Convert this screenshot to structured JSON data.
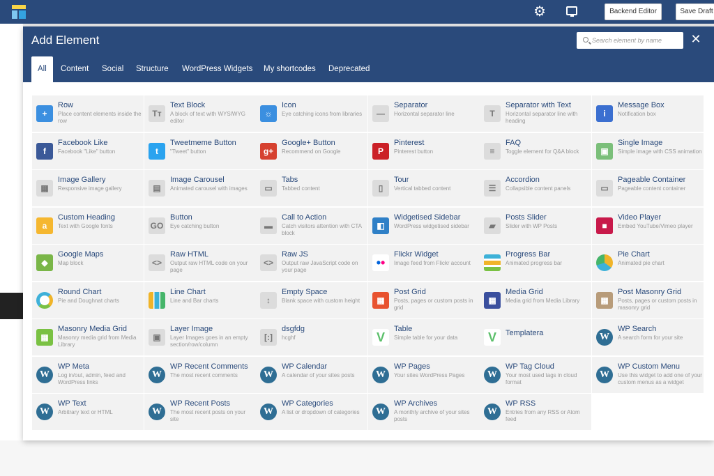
{
  "topbar": {
    "backend_editor": "Backend Editor",
    "save_draft": "Save Draft"
  },
  "modal": {
    "title": "Add Element",
    "search_placeholder": "Search element by name",
    "close": "✕",
    "tabs": [
      "All",
      "Content",
      "Social",
      "Structure",
      "WordPress Widgets",
      "My shortcodes",
      "Deprecated"
    ],
    "active_tab": "All"
  },
  "colors": {
    "header_bg": "#2a4a7b",
    "item_title": "#2a4a7b",
    "item_desc": "#999999",
    "item_bg": "#f2f2f2"
  },
  "elements": [
    [
      {
        "name": "Row",
        "desc": "Place content elements inside the row",
        "icon": "plus-icon",
        "glyph": "+",
        "color": "#3b8fe0"
      },
      {
        "name": "Text Block",
        "desc": "A block of text with WYSIWYG editor",
        "icon": "text-icon",
        "glyph": "Tт",
        "color": "light"
      },
      {
        "name": "Icon",
        "desc": "Eye catching icons from libraries",
        "icon": "sun-icon",
        "glyph": "☼",
        "color": "#3b8fe0"
      },
      {
        "name": "Separator",
        "desc": "Horizontal separator line",
        "icon": "separator-icon",
        "glyph": "—",
        "color": "light"
      },
      {
        "name": "Separator with Text",
        "desc": "Horizontal separator line with heading",
        "icon": "separator-text-icon",
        "glyph": "T",
        "color": "light"
      },
      {
        "name": "Message Box",
        "desc": "Notification box",
        "icon": "info-icon",
        "glyph": "i",
        "color": "#3b6fd0"
      }
    ],
    [
      {
        "name": "Facebook Like",
        "desc": "Facebook \"Like\" button",
        "icon": "facebook-icon",
        "glyph": "f",
        "color": "#3b5998"
      },
      {
        "name": "Tweetmeme Button",
        "desc": "\"Tweet\" button",
        "icon": "twitter-icon",
        "glyph": "t",
        "color": "#2aa3ef"
      },
      {
        "name": "Google+ Button",
        "desc": "Recommend on Google",
        "icon": "google-plus-icon",
        "glyph": "g+",
        "color": "#d6412f"
      },
      {
        "name": "Pinterest",
        "desc": "Pinterest button",
        "icon": "pinterest-icon",
        "glyph": "P",
        "color": "#cb2027"
      },
      {
        "name": "FAQ",
        "desc": "Toggle element for Q&A block",
        "icon": "faq-icon",
        "glyph": "≡",
        "color": "light"
      },
      {
        "name": "Single Image",
        "desc": "Simple image with CSS animation",
        "icon": "image-icon",
        "glyph": "▣",
        "color": "#7bbf7a"
      }
    ],
    [
      {
        "name": "Image Gallery",
        "desc": "Responsive image gallery",
        "icon": "gallery-icon",
        "glyph": "▦",
        "color": "light"
      },
      {
        "name": "Image Carousel",
        "desc": "Animated carousel with images",
        "icon": "carousel-icon",
        "glyph": "▤",
        "color": "light"
      },
      {
        "name": "Tabs",
        "desc": "Tabbed content",
        "icon": "tabs-icon",
        "glyph": "▭",
        "color": "light"
      },
      {
        "name": "Tour",
        "desc": "Vertical tabbed content",
        "icon": "tour-icon",
        "glyph": "▯",
        "color": "light"
      },
      {
        "name": "Accordion",
        "desc": "Collapsible content panels",
        "icon": "accordion-icon",
        "glyph": "☰",
        "color": "light"
      },
      {
        "name": "Pageable Container",
        "desc": "Pageable content container",
        "icon": "pageable-icon",
        "glyph": "▭",
        "color": "light"
      }
    ],
    [
      {
        "name": "Custom Heading",
        "desc": "Text with Google fonts",
        "icon": "heading-icon",
        "glyph": "a",
        "color": "#f5b730"
      },
      {
        "name": "Button",
        "desc": "Eye catching button",
        "icon": "button-icon",
        "glyph": "GO",
        "color": "light"
      },
      {
        "name": "Call to Action",
        "desc": "Catch visitors attention with CTA block",
        "icon": "cta-icon",
        "glyph": "▬",
        "color": "light"
      },
      {
        "name": "Widgetised Sidebar",
        "desc": "WordPress widgetised sidebar",
        "icon": "sidebar-icon",
        "glyph": "◧",
        "color": "#2f80c7"
      },
      {
        "name": "Posts Slider",
        "desc": "Slider with WP Posts",
        "icon": "slider-icon",
        "glyph": "▰",
        "color": "light"
      },
      {
        "name": "Video Player",
        "desc": "Embed YouTube/Vimeo player",
        "icon": "video-icon",
        "glyph": "■",
        "color": "#c8194a"
      }
    ],
    [
      {
        "name": "Google Maps",
        "desc": "Map block",
        "icon": "map-icon",
        "glyph": "◆",
        "color": "#7ab648"
      },
      {
        "name": "Raw HTML",
        "desc": "Output raw HTML code on your page",
        "icon": "html-icon",
        "glyph": "<>",
        "color": "light"
      },
      {
        "name": "Raw JS",
        "desc": "Output raw JavaScript code on your page",
        "icon": "js-icon",
        "glyph": "<>",
        "color": "light"
      },
      {
        "name": "Flickr Widget",
        "desc": "Image feed from Flickr account",
        "icon": "flickr-icon",
        "glyph": "••",
        "color": "flickr"
      },
      {
        "name": "Progress Bar",
        "desc": "Animated progress bar",
        "icon": "progress-icon",
        "glyph": "≡",
        "color": "progress"
      },
      {
        "name": "Pie Chart",
        "desc": "Animated pie chart",
        "icon": "pie-chart-icon",
        "glyph": "",
        "color": "pie"
      }
    ],
    [
      {
        "name": "Round Chart",
        "desc": "Pie and Doughnat charts",
        "icon": "round-chart-icon",
        "glyph": "",
        "color": "donut"
      },
      {
        "name": "Line Chart",
        "desc": "Line and Bar charts",
        "icon": "line-chart-icon",
        "glyph": "▮",
        "color": "bars"
      },
      {
        "name": "Empty Space",
        "desc": "Blank space with custom height",
        "icon": "empty-space-icon",
        "glyph": "↕",
        "color": "light"
      },
      {
        "name": "Post Grid",
        "desc": "Posts, pages or custom posts in grid",
        "icon": "post-grid-icon",
        "glyph": "▦",
        "color": "#e8522f"
      },
      {
        "name": "Media Grid",
        "desc": "Media grid from Media Library",
        "icon": "media-grid-icon",
        "glyph": "▦",
        "color": "#3a4f9e"
      },
      {
        "name": "Post Masonry Grid",
        "desc": "Posts, pages or custom posts in masonry grid",
        "icon": "masonry-icon",
        "glyph": "▦",
        "color": "#b89c7a"
      }
    ],
    [
      {
        "name": "Masonry Media Grid",
        "desc": "Masonry media grid from Media Library",
        "icon": "masonry-media-icon",
        "glyph": "▦",
        "color": "#7ac143"
      },
      {
        "name": "Layer Image",
        "desc": "Layer Images goes in an empty section/row/column",
        "icon": "layer-image-icon",
        "glyph": "▣",
        "color": "light"
      },
      {
        "name": "dsgfdg",
        "desc": "hcghf",
        "icon": "shortcode-icon",
        "glyph": "[:]",
        "color": "light"
      },
      {
        "name": "Table",
        "desc": "Simple table for your data",
        "icon": "table-icon",
        "glyph": "V",
        "color": "templatera"
      },
      {
        "name": "Templatera",
        "desc": "",
        "icon": "templatera-icon",
        "glyph": "V",
        "color": "templatera"
      },
      {
        "name": "WP Search",
        "desc": "A search form for your site",
        "icon": "wordpress-icon",
        "glyph": "W",
        "color": "wp"
      }
    ],
    [
      {
        "name": "WP Meta",
        "desc": "Log in/out, admin, feed and WordPress links",
        "icon": "wordpress-icon",
        "glyph": "W",
        "color": "wp"
      },
      {
        "name": "WP Recent Comments",
        "desc": "The most recent comments",
        "icon": "wordpress-icon",
        "glyph": "W",
        "color": "wp"
      },
      {
        "name": "WP Calendar",
        "desc": "A calendar of your sites posts",
        "icon": "wordpress-icon",
        "glyph": "W",
        "color": "wp"
      },
      {
        "name": "WP Pages",
        "desc": "Your sites WordPress Pages",
        "icon": "wordpress-icon",
        "glyph": "W",
        "color": "wp"
      },
      {
        "name": "WP Tag Cloud",
        "desc": "Your most used tags in cloud format",
        "icon": "wordpress-icon",
        "glyph": "W",
        "color": "wp"
      },
      {
        "name": "WP Custom Menu",
        "desc": "Use this widget to add one of your custom menus as a widget",
        "icon": "wordpress-icon",
        "glyph": "W",
        "color": "wp"
      }
    ],
    [
      {
        "name": "WP Text",
        "desc": "Arbitrary text or HTML",
        "icon": "wordpress-icon",
        "glyph": "W",
        "color": "wp"
      },
      {
        "name": "WP Recent Posts",
        "desc": "The most recent posts on your site",
        "icon": "wordpress-icon",
        "glyph": "W",
        "color": "wp"
      },
      {
        "name": "WP Categories",
        "desc": "A list or dropdown of categories",
        "icon": "wordpress-icon",
        "glyph": "W",
        "color": "wp"
      },
      {
        "name": "WP Archives",
        "desc": "A monthly archive of your sites posts",
        "icon": "wordpress-icon",
        "glyph": "W",
        "color": "wp"
      },
      {
        "name": "WP RSS",
        "desc": "Entries from any RSS or Atom feed",
        "icon": "wordpress-icon",
        "glyph": "W",
        "color": "wp"
      }
    ]
  ]
}
